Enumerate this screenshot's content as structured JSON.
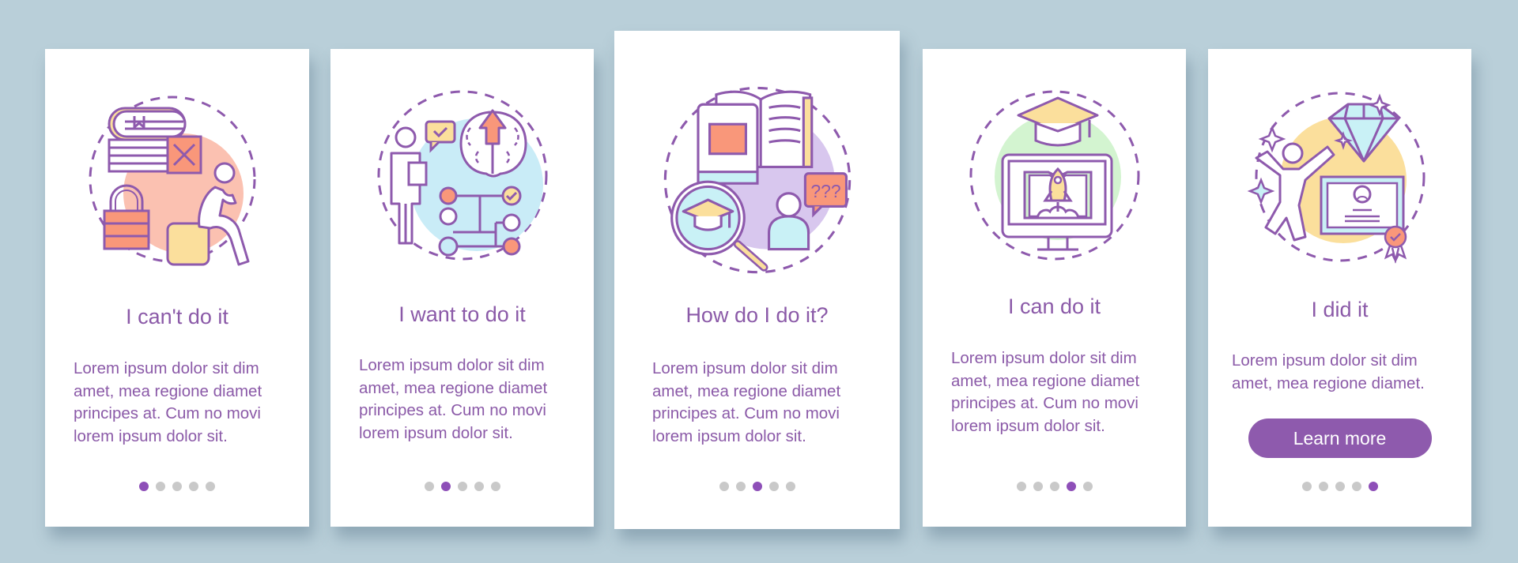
{
  "colors": {
    "background": "#b9cfd9",
    "accent": "#8e5aad",
    "text": "#8b5aa8",
    "dot_inactive": "#c9c9c9",
    "dot_active": "#8e4fb8"
  },
  "cards": [
    {
      "title": "I can't do it",
      "body": "Lorem ipsum dolor sit dim\namet, mea regione diamet\nprincipes at. Cum no movi\nlorem ipsum dolor sit.",
      "illustration": "frustrated-person-books-lock-icon",
      "blob_color": "#fbc1b1",
      "active_dot": 1
    },
    {
      "title": "I want to do it",
      "body": "Lorem ipsum dolor sit dim\namet, mea regione diamet\nprincipes at. Cum no movi\nlorem ipsum dolor sit.",
      "illustration": "person-brain-decision-tree-icon",
      "blob_color": "#c9ecf7",
      "active_dot": 2
    },
    {
      "title": "How do I do it?",
      "body": "Lorem ipsum dolor sit dim\namet, mea regione diamet\nprincipes at. Cum no movi\nlorem ipsum dolor sit.",
      "illustration": "books-magnifier-question-icon",
      "blob_color": "#d8c7ee",
      "bubble_text": "???",
      "active_dot": 3
    },
    {
      "title": "I can do it",
      "body": "Lorem ipsum dolor sit dim\namet, mea regione diamet\nprincipes at. Cum no movi\nlorem ipsum dolor sit.",
      "illustration": "monitor-rocket-graduation-icon",
      "blob_color": "#d3f4d0",
      "active_dot": 4
    },
    {
      "title": "I did it",
      "body": "Lorem ipsum dolor sit dim\namet, mea regione diamet.",
      "illustration": "celebrating-person-diamond-certificate-icon",
      "blob_color": "#fbdf9c",
      "button_label": "Learn more",
      "active_dot": 5
    }
  ],
  "pagination": {
    "total": 5
  }
}
